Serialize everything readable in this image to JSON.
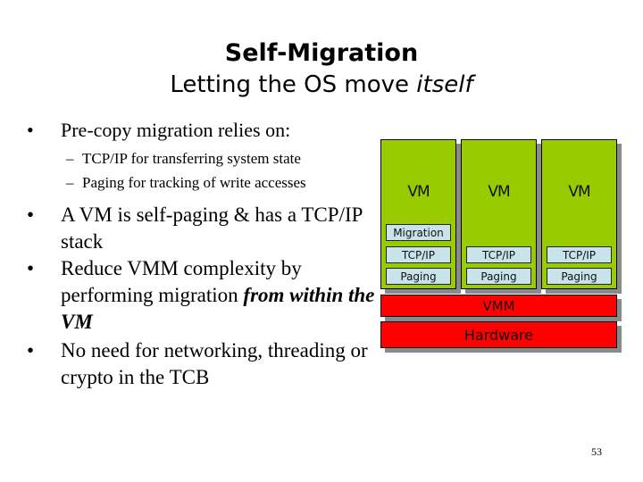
{
  "slide": {
    "title": "Self-Migration",
    "subtitle_plain": "Letting the OS move ",
    "subtitle_italic": "itself",
    "page_number": "53"
  },
  "bullets": {
    "b1": "Pre-copy migration relies on:",
    "b1_sub": [
      "TCP/IP for transferring system state",
      "Paging for tracking of write accesses"
    ],
    "b2": "A VM is self-paging & has a TCP/IP stack",
    "b3_plain": "Reduce VMM complexity by performing migration ",
    "b3_emph": "from within the VM",
    "b4": "No need for networking, threading or crypto in the TCB",
    "bullet_glyph": "•",
    "dash_glyph": "–"
  },
  "diagram": {
    "vms": [
      {
        "label": "VM",
        "layers": [
          "Migration",
          "TCP/IP",
          "Paging"
        ]
      },
      {
        "label": "VM",
        "layers": [
          "TCP/IP",
          "Paging"
        ]
      },
      {
        "label": "VM",
        "layers": [
          "TCP/IP",
          "Paging"
        ]
      }
    ],
    "vmm_label": "VMM",
    "hardware_label": "Hardware",
    "colors": {
      "vm": "#99cc00",
      "layer": "#c8e4ea",
      "base": "#ff0000"
    }
  }
}
